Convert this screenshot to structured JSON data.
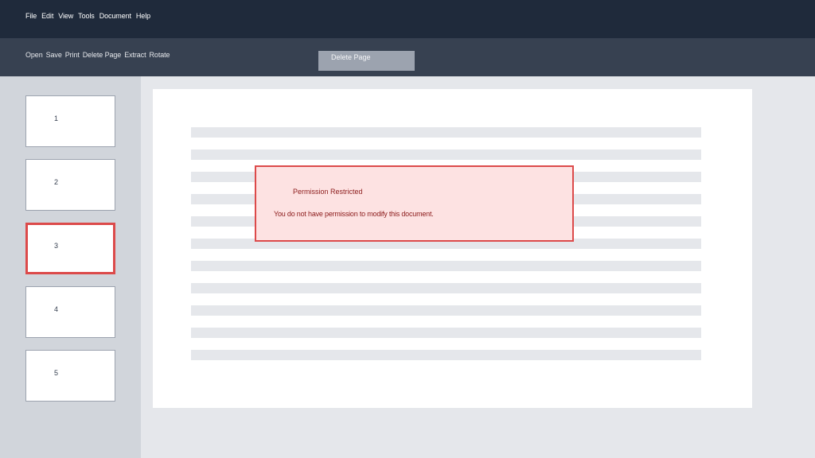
{
  "menu": [
    "File",
    "Edit",
    "View",
    "Tools",
    "Document",
    "Help"
  ],
  "toolbar": [
    "Open",
    "Save",
    "Print",
    "Delete Page",
    "Extract",
    "Rotate"
  ],
  "tooltip": "Delete Page",
  "thumbnails": [
    "1",
    "2",
    "3",
    "4",
    "5"
  ],
  "selected_page": "3",
  "alert": {
    "title": "Permission Restricted",
    "message": "You do not have permission to modify this document."
  },
  "colors": {
    "menubar": "#1f2a3b",
    "toolbar": "#374151",
    "alert_border": "#dc4a4a",
    "alert_bg": "#fde2e2"
  }
}
